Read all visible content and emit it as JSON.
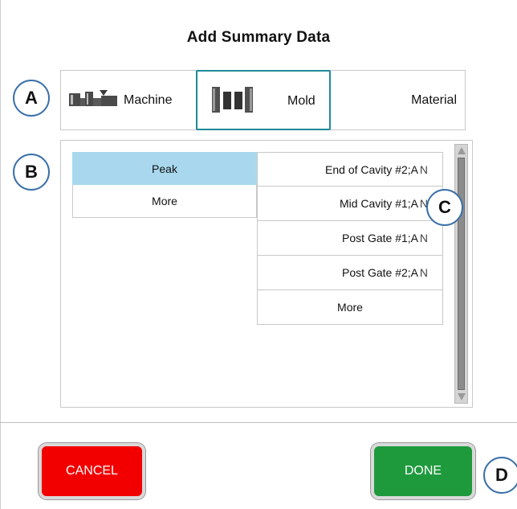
{
  "dialog": {
    "title": "Add Summary Data"
  },
  "tabs": [
    {
      "label": "Machine",
      "icon": "machine-icon"
    },
    {
      "label": "Mold",
      "icon": "mold-icon",
      "selected": true
    },
    {
      "label": "Material"
    }
  ],
  "left_list": {
    "items": [
      {
        "label": "Peak",
        "selected": true
      },
      {
        "label": "More"
      }
    ]
  },
  "right_list": {
    "items": [
      {
        "label": "End of Cavity #2;A",
        "suffix": "N"
      },
      {
        "label": "Mid Cavity #1;A",
        "suffix": "N"
      },
      {
        "label": "Post Gate #1;A",
        "suffix": "N"
      },
      {
        "label": "Post Gate #2;A",
        "suffix": "N"
      },
      {
        "label": "More"
      }
    ]
  },
  "buttons": {
    "cancel": "CANCEL",
    "done": "DONE"
  },
  "callouts": {
    "a": "A",
    "b": "B",
    "c": "C",
    "d": "D"
  },
  "colors": {
    "selected_bg": "#a9d8ee",
    "mold_tab_border": "#1f8a98",
    "cancel": "#f20000",
    "done": "#1e9a3d",
    "callout_border": "#3a6fa8"
  }
}
